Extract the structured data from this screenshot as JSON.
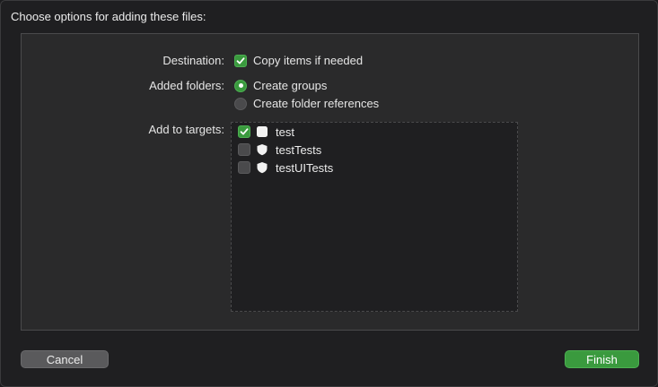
{
  "dialog": {
    "title": "Choose options for adding these files:"
  },
  "destination": {
    "label": "Destination:",
    "option_label": "Copy items if needed",
    "checked": true
  },
  "added_folders": {
    "label": "Added folders:",
    "options": [
      {
        "label": "Create groups",
        "selected": true
      },
      {
        "label": "Create folder references",
        "selected": false
      }
    ]
  },
  "targets": {
    "label": "Add to targets:",
    "items": [
      {
        "name": "test",
        "checked": true,
        "icon": "app-target-icon"
      },
      {
        "name": "testTests",
        "checked": false,
        "icon": "test-shield-icon"
      },
      {
        "name": "testUITests",
        "checked": false,
        "icon": "test-shield-icon"
      }
    ]
  },
  "buttons": {
    "cancel_label": "Cancel",
    "finish_label": "Finish"
  },
  "colors": {
    "accent": "#3a9a3e",
    "background": "#1f1f21",
    "panel": "#2a2a2b"
  }
}
